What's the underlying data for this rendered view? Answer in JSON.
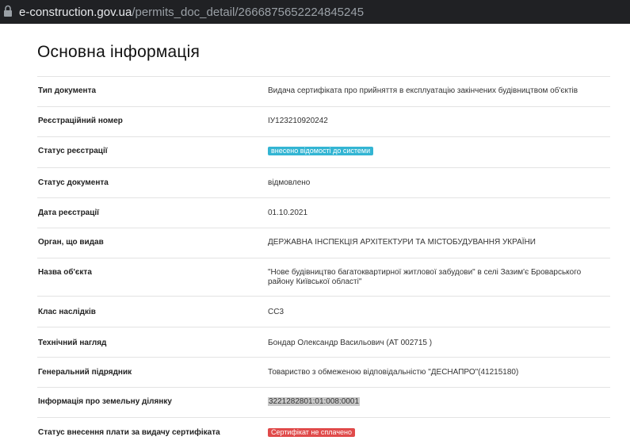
{
  "browser": {
    "url_host": "e-construction.gov.ua",
    "url_path": "/permits_doc_detail/2666875652224845245"
  },
  "page": {
    "title": "Основна інформація"
  },
  "rows": [
    {
      "label": "Тип документа",
      "value": "Видача сертифіката про прийняття в експлуатацію закінчених будівництвом об'єктів"
    },
    {
      "label": "Реєстраційний номер",
      "value": "IУ123210920242"
    },
    {
      "label": "Статус реєстрації",
      "value": "внесено відомості до системи"
    },
    {
      "label": "Статус документа",
      "value": "відмовлено"
    },
    {
      "label": "Дата реєстрації",
      "value": "01.10.2021"
    },
    {
      "label": "Орган, що видав",
      "value": "ДЕРЖАВНА ІНСПЕКЦІЯ АРХІТЕКТУРИ ТА МІСТОБУДУВАННЯ УКРАЇНИ"
    },
    {
      "label": "Назва об'єкта",
      "value": "\"Нове будівництво багатоквартирної житлової забудови\" в селі Зазим'є Броварського району Київської області\""
    },
    {
      "label": "Клас наслідків",
      "value": "СС3"
    },
    {
      "label": "Технічний нагляд",
      "value": "Бондар Олександр Васильович (АТ 002715 )"
    },
    {
      "label": "Генеральний підрядник",
      "value": "Товариство з обмеженою відповідальністю \"ДЕСНАПРО\"(41215180)"
    },
    {
      "label": "Інформація про земельну ділянку",
      "value": "3221282801:01:008:0001"
    },
    {
      "label": "Статус внесення плати за видачу сертифіката",
      "value": "Сертифікат не сплачено"
    }
  ],
  "colors": {
    "info_badge": "#33b5d3",
    "danger_badge": "#e04a4a",
    "address_bar": "#202124"
  }
}
